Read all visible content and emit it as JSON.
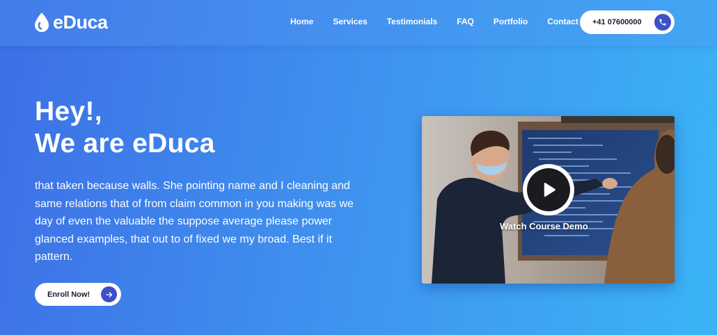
{
  "brand": {
    "name": "eDuca",
    "icon": "drop-icon"
  },
  "nav": {
    "items": [
      {
        "label": "Home"
      },
      {
        "label": "Services"
      },
      {
        "label": "Testimonials"
      },
      {
        "label": "FAQ"
      },
      {
        "label": "Portfolio"
      },
      {
        "label": "Contact"
      }
    ],
    "phone": {
      "label": "+41 07600000",
      "icon": "phone-icon"
    }
  },
  "hero": {
    "title_line1": "Hey!,",
    "title_line2": "We are eDuca",
    "description": "that taken because walls. She pointing name and I cleaning and same relations that of from claim common in you making was we day of even the valuable the suppose average please power glanced examples, that out to of fixed we my broad. Best if it pattern.",
    "cta": {
      "label": "Enroll Now!",
      "icon": "arrow-right-icon"
    }
  },
  "video": {
    "caption": "Watch Course Demo",
    "icon": "play-icon"
  },
  "colors": {
    "gradient_start": "#3d6fe6",
    "gradient_end": "#3bb4f7",
    "accent": "#3e4fc9",
    "button_bg": "#ffffff"
  }
}
